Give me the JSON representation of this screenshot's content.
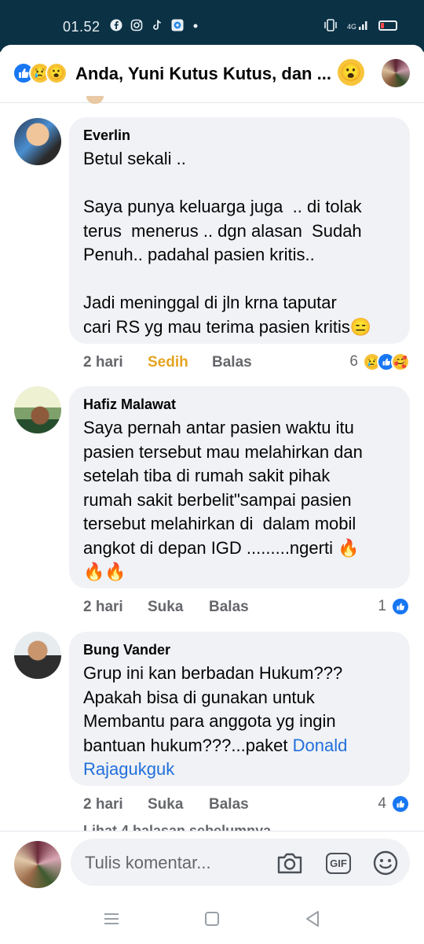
{
  "status_bar": {
    "time": "01.52",
    "icons": [
      "facebook-icon",
      "instagram-icon",
      "tiktok-icon",
      "messenger-icon",
      "dot-icon"
    ],
    "right_icons": [
      "vibrate-icon",
      "signal-4g-icon",
      "battery-low-icon"
    ],
    "network": "4G"
  },
  "header": {
    "title": "Anda, Yuni Kutus Kutus, dan ...",
    "reactions": [
      "like-icon",
      "sad-icon",
      "wow-icon"
    ],
    "wow_emoji": "😮"
  },
  "comments": [
    {
      "name": "Everlin",
      "text": "Betul sekali ..\n\nSaya punya keluarga juga  .. di tolak\nterus  menerus .. dgn alasan  Sudah\nPenuh.. padahal pasien kritis..\n\nJadi meninggal di jln krna taputar\ncari RS yg mau terima pasien kritis😑",
      "time": "2 hari",
      "reaction_label": "Sedih",
      "reply_label": "Balas",
      "reaction_count": "6",
      "reaction_icons": [
        "sad-icon",
        "like-icon",
        "care-icon"
      ]
    },
    {
      "name": "Hafiz Malawat",
      "text": "Saya pernah antar pasien waktu itu\npasien tersebut mau melahirkan dan\nsetelah tiba di rumah sakit pihak\nrumah sakit berbelit\"sampai pasien\ntersebut melahirkan di  dalam mobil\nangkot di depan IGD .........ngerti 🔥\n🔥🔥",
      "time": "2 hari",
      "reaction_label": "Suka",
      "reply_label": "Balas",
      "reaction_count": "1",
      "reaction_icons": [
        "like-icon"
      ]
    },
    {
      "name": "Bung Vander",
      "text_before_mention": "Grup ini kan berbadan Hukum???\nApakah bisa di gunakan untuk\nMembantu para anggota yg ingin\nbantuan hukum???...paket ",
      "mention": "Donald\nRajagukguk",
      "time": "2 hari",
      "reaction_label": "Suka",
      "reply_label": "Balas",
      "reaction_count": "4",
      "reaction_icons": [
        "like-icon"
      ]
    }
  ],
  "more_replies": "Lihat 4 balasan sebelumnya",
  "composer": {
    "placeholder": "Tulis komentar...",
    "gif_label": "GIF"
  },
  "colors": {
    "status_bar_bg": "#0b3145",
    "bubble_bg": "#f0f2f5",
    "link": "#216fdb",
    "sedih": "#e5a421",
    "like_blue": "#1877f2"
  }
}
